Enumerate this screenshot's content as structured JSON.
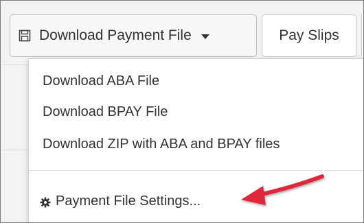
{
  "toolbar": {
    "download_label": "Download Payment File",
    "payslips_label": "Pay Slips"
  },
  "menu": {
    "items": [
      {
        "label": "Download ABA File"
      },
      {
        "label": "Download BPAY File"
      },
      {
        "label": "Download ZIP with ABA and BPAY files"
      }
    ],
    "settings_label": "Payment File Settings..."
  },
  "icons": {
    "download_button": "save-icon",
    "caret": "caret-down-icon",
    "settings": "gear-icon"
  },
  "colors": {
    "text": "#333333",
    "annotation_arrow": "#e0283a"
  }
}
